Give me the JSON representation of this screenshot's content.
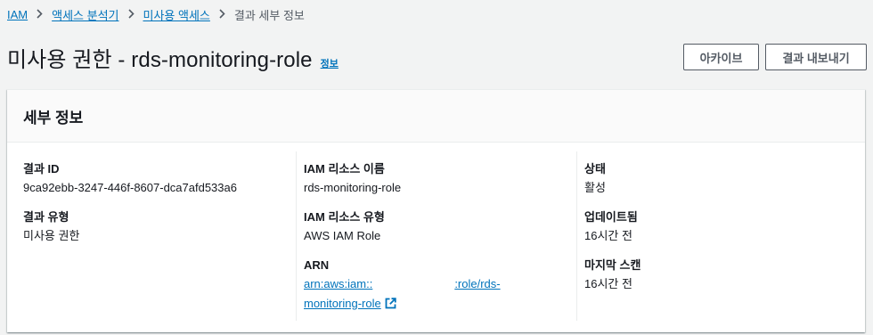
{
  "breadcrumb": {
    "items": [
      "IAM",
      "액세스 분석기",
      "미사용 액세스"
    ],
    "current": "결과 세부 정보"
  },
  "header": {
    "title": "미사용 권한 - rds-monitoring-role",
    "info_label": "정보",
    "archive_label": "아카이브",
    "export_label": "결과 내보내기"
  },
  "details": {
    "section_title": "세부 정보",
    "finding_id_label": "결과 ID",
    "finding_id": "9ca92ebb-3247-446f-8607-dca7afd533a6",
    "finding_type_label": "결과 유형",
    "finding_type": "미사용 권한",
    "resource_name_label": "IAM 리소스 이름",
    "resource_name": "rds-monitoring-role",
    "resource_type_label": "IAM 리소스 유형",
    "resource_type": "AWS IAM Role",
    "arn_label": "ARN",
    "arn_prefix": "arn:aws:iam::",
    "arn_suffix": ":role/rds-",
    "arn_suffix2": "monitoring-role",
    "status_label": "상태",
    "status": "활성",
    "updated_label": "업데이트됨",
    "updated": "16시간 전",
    "last_scan_label": "마지막 스캔",
    "last_scan": "16시간 전"
  },
  "icons": {
    "breadcrumb_separator": "chevron-right-icon",
    "arn_external": "external-link-icon"
  },
  "colors": {
    "link": "#0073bb",
    "text": "#16191f",
    "muted": "#545b64",
    "background": "#f2f3f3"
  }
}
